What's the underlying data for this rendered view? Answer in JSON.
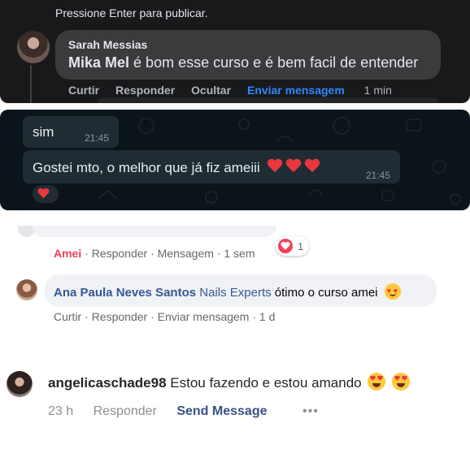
{
  "fb_dark": {
    "hint": "Pressione Enter para publicar.",
    "author": "Sarah Messias",
    "mention": "Mika Mel",
    "text": "é bom esse curso e é bem facil de entender",
    "actions": {
      "like": "Curtir",
      "reply": "Responder",
      "hide": "Ocultar",
      "message": "Enviar mensagem",
      "time": "1 min"
    },
    "colors": {
      "background": "#18191a",
      "bubble": "#3a3b3c",
      "link": "#2d88ff"
    }
  },
  "whatsapp": {
    "messages": [
      {
        "text": "sim",
        "time": "21:45"
      },
      {
        "text": "Gostei mto, o melhor que já fiz ameiii",
        "time": "21:45",
        "emoji": [
          "red-heart",
          "red-heart",
          "red-heart"
        ]
      }
    ],
    "reaction": "red-heart",
    "colors": {
      "background": "#0b141a",
      "bubble": "#1f2c34"
    }
  },
  "fb_light": {
    "comment1": {
      "reaction_label": "Amei",
      "reply": "Responder",
      "message": "Mensagem",
      "time": "1 sem",
      "reaction_count": "1",
      "reaction_icon": "love-icon"
    },
    "comment2": {
      "author": "Ana Paula Neves Santos",
      "tag": "Nails Experts",
      "text": "ótimo o curso amei",
      "emoji": "smiling-face-with-hearts",
      "actions": {
        "like": "Curtir",
        "reply": "Responder",
        "message": "Enviar mensagem",
        "time": "1 d"
      }
    },
    "colors": {
      "name": "#385898",
      "love": "#f33e58",
      "bubble": "#f0f2f5"
    }
  },
  "instagram": {
    "username": "angelicaschade98",
    "text": "Estou fazendo e estou amando",
    "emoji": [
      "heart-eyes",
      "heart-eyes"
    ],
    "time": "23 h",
    "reply": "Responder",
    "send": "Send Message",
    "more": "•••",
    "colors": {
      "send": "#385185",
      "muted": "#8e8e8e"
    }
  }
}
